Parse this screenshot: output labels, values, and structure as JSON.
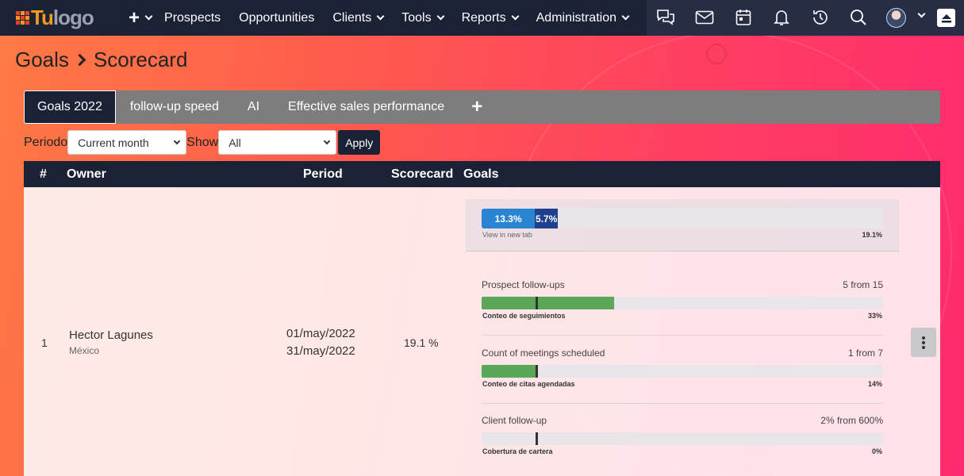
{
  "navbar": {
    "logo_tu": "Tu",
    "logo_text": "logo",
    "menu": [
      {
        "label": "Prospects",
        "has_dropdown": false
      },
      {
        "label": "Opportunities",
        "has_dropdown": false
      },
      {
        "label": "Clients",
        "has_dropdown": true
      },
      {
        "label": "Tools",
        "has_dropdown": true
      },
      {
        "label": "Reports",
        "has_dropdown": true
      },
      {
        "label": "Administration",
        "has_dropdown": true
      }
    ],
    "icons": [
      "chat-icon",
      "mail-icon",
      "calendar-icon",
      "bell-icon",
      "history-icon",
      "search-icon"
    ]
  },
  "breadcrumb": {
    "parent": "Goals",
    "current": "Scorecard"
  },
  "tabs": [
    {
      "label": "Goals 2022",
      "active": true
    },
    {
      "label": "follow-up speed",
      "active": false
    },
    {
      "label": "AI",
      "active": false
    },
    {
      "label": "Effective sales performance",
      "active": false
    }
  ],
  "filters": {
    "period_label": "Periodo",
    "period_value": "Current month",
    "show_label": "Show",
    "show_value": "All",
    "apply_label": "Apply"
  },
  "table": {
    "headers": {
      "num": "#",
      "owner": "Owner",
      "period": "Period",
      "scorecard": "Scorecard",
      "goals": "Goals"
    },
    "rows": [
      {
        "num": "1",
        "owner_name": "Hector Lagunes",
        "owner_country": "México",
        "period_start": "01/may/2022",
        "period_end": "31/may/2022",
        "scorecard": "19.1 %",
        "summary": {
          "segment_a_label": "13.3%",
          "segment_a_value": 13.3,
          "segment_b_label": "5.7%",
          "segment_b_value": 5.7,
          "link_label": "View in new tab",
          "total_label": "19.1%"
        },
        "goals": [
          {
            "title": "Prospect follow-ups",
            "count": "5 from 15",
            "subtitle": "Conteo de seguimientos",
            "percent_label": "33%",
            "progress": 33
          },
          {
            "title": "Count of meetings scheduled",
            "count": "1 from 7",
            "subtitle": "Conteo de citas agendadas",
            "percent_label": "14%",
            "progress": 14
          },
          {
            "title": "Client follow-up",
            "count": "2% from 600%",
            "subtitle": "Cobertura de cartera",
            "percent_label": "0%",
            "progress": 0
          }
        ]
      }
    ]
  },
  "colors": {
    "navbar": "#1c2236",
    "segment_a": "#2a84d2",
    "segment_b": "#1f3f8f",
    "goal_fill": "#5aa757"
  }
}
